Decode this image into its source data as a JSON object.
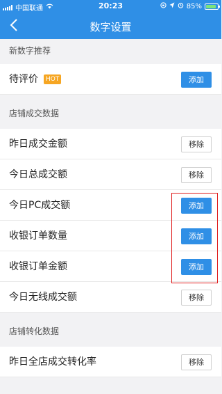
{
  "status_bar": {
    "carrier": "中国联通",
    "time": "20:23",
    "battery": "85%",
    "battery_level": 0.85
  },
  "nav": {
    "back_icon": "chevron-left-icon",
    "title": "数字设置"
  },
  "sections": [
    {
      "header": "新数字推荐",
      "rows": [
        {
          "label": "待评价",
          "badge": "HOT",
          "action": "添加"
        }
      ]
    },
    {
      "header": "店铺成交数据",
      "rows": [
        {
          "label": "昨日成交金额",
          "action": "移除"
        },
        {
          "label": "今日总成交额",
          "action": "移除"
        },
        {
          "label": "今日PC成交额",
          "action": "添加"
        },
        {
          "label": "收银订单数量",
          "action": "添加"
        },
        {
          "label": "收银订单金额",
          "action": "添加"
        },
        {
          "label": "今日无线成交额",
          "action": "移除"
        }
      ]
    },
    {
      "header": "店铺转化数据",
      "rows": [
        {
          "label": "昨日全店成交转化率",
          "action": "移除"
        }
      ]
    }
  ],
  "colors": {
    "accent": "#2f8fe6",
    "hot": "#f6a623",
    "highlight": "#e02020"
  }
}
